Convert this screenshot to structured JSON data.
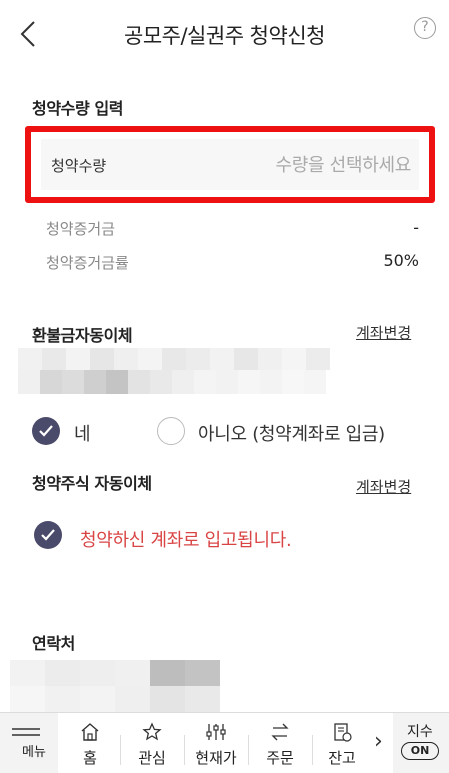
{
  "header": {
    "title": "공모주/실권주 청약신청",
    "help_glyph": "?"
  },
  "qty_section": {
    "title": "청약수량 입력",
    "field_label": "청약수량",
    "placeholder": "수량을 선택하세요",
    "deposit_label": "청약증거금",
    "deposit_value": "-",
    "deposit_rate_label": "청약증거금률",
    "deposit_rate_value": "50%"
  },
  "refund_section": {
    "title": "환불금자동이체",
    "change_link": "계좌변경",
    "yes_label": "네",
    "no_label": "아니오 (청약계좌로 입금)"
  },
  "stock_section": {
    "title": "청약주식 자동이체",
    "change_link": "계좌변경",
    "notice": "청약하신 계좌로 입고됩니다."
  },
  "contact_section": {
    "title": "연락처"
  },
  "bottom_nav": {
    "menu": "메뉴",
    "items": [
      "홈",
      "관심",
      "현재가",
      "주문",
      "잔고"
    ],
    "more": "›",
    "index_label": "지수",
    "index_toggle": "ON"
  },
  "colors": {
    "highlight": "#ee1111",
    "radio_on": "#4a4a6a",
    "notice": "#d94545"
  },
  "icons": [
    "back-icon",
    "help-icon",
    "check-icon",
    "menu-icon",
    "home-icon",
    "star-icon",
    "sliders-icon",
    "swap-icon",
    "receipt-icon",
    "chevron-right-icon"
  ]
}
